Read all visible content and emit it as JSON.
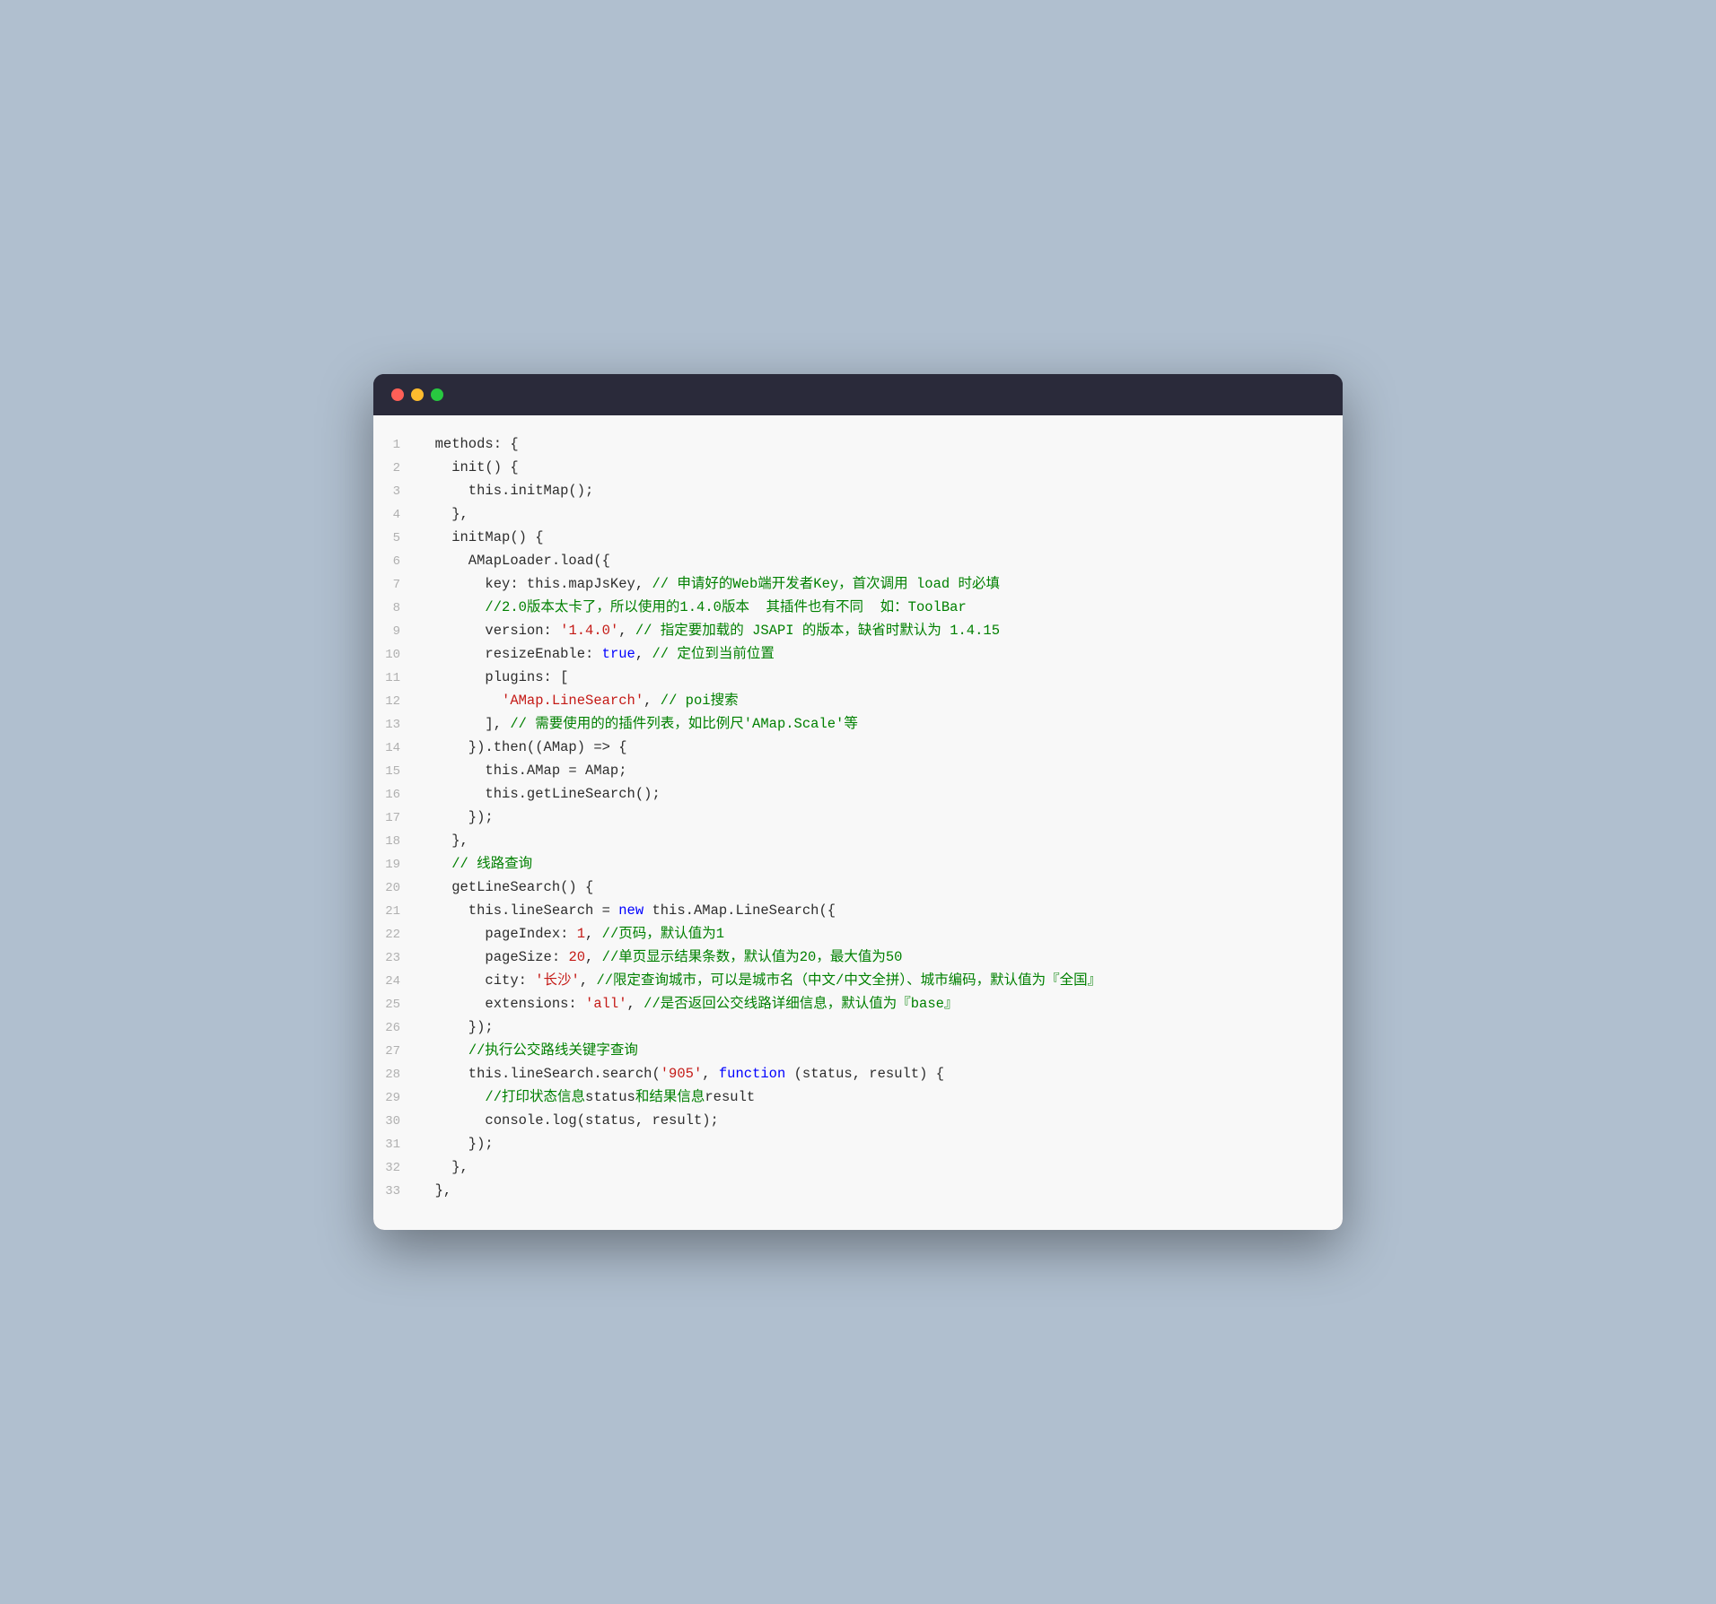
{
  "window": {
    "dots": [
      "red",
      "yellow",
      "green"
    ]
  },
  "lines": [
    {
      "num": 1,
      "tokens": [
        {
          "t": "  methods: {",
          "c": "c-default"
        }
      ]
    },
    {
      "num": 2,
      "tokens": [
        {
          "t": "    init() {",
          "c": "c-default"
        }
      ]
    },
    {
      "num": 3,
      "tokens": [
        {
          "t": "      this.initMap();",
          "c": "c-default"
        }
      ]
    },
    {
      "num": 4,
      "tokens": [
        {
          "t": "    },",
          "c": "c-default"
        }
      ]
    },
    {
      "num": 5,
      "tokens": [
        {
          "t": "    initMap() {",
          "c": "c-default"
        }
      ]
    },
    {
      "num": 6,
      "tokens": [
        {
          "t": "      AMapLoader.load({",
          "c": "c-default"
        }
      ]
    },
    {
      "num": 7,
      "tokens": [
        {
          "t": "        key: this.mapJsKey, ",
          "c": "c-default"
        },
        {
          "t": "// 申请好的Web端开发者Key，首次调用 load 时必填",
          "c": "c-comment"
        }
      ]
    },
    {
      "num": 8,
      "tokens": [
        {
          "t": "        ",
          "c": "c-default"
        },
        {
          "t": "//2.0版本太卡了，所以使用的1.4.0版本  其插件也有不同  如：ToolBar",
          "c": "c-comment"
        }
      ]
    },
    {
      "num": 9,
      "tokens": [
        {
          "t": "        version: ",
          "c": "c-default"
        },
        {
          "t": "'1.4.0'",
          "c": "c-string"
        },
        {
          "t": ", ",
          "c": "c-default"
        },
        {
          "t": "// 指定要加载的 JSAPI 的版本，缺省时默认为 1.4.15",
          "c": "c-comment"
        }
      ]
    },
    {
      "num": 10,
      "tokens": [
        {
          "t": "        resizeEnable: ",
          "c": "c-default"
        },
        {
          "t": "true",
          "c": "c-bool"
        },
        {
          "t": ", ",
          "c": "c-default"
        },
        {
          "t": "// 定位到当前位置",
          "c": "c-comment"
        }
      ]
    },
    {
      "num": 11,
      "tokens": [
        {
          "t": "        plugins: [",
          "c": "c-default"
        }
      ]
    },
    {
      "num": 12,
      "tokens": [
        {
          "t": "          ",
          "c": "c-default"
        },
        {
          "t": "'AMap.LineSearch'",
          "c": "c-string"
        },
        {
          "t": ", ",
          "c": "c-default"
        },
        {
          "t": "// poi搜索",
          "c": "c-comment"
        }
      ]
    },
    {
      "num": 13,
      "tokens": [
        {
          "t": "        ], ",
          "c": "c-default"
        },
        {
          "t": "// 需要使用的的插件列表，如比例尺'AMap.Scale'等",
          "c": "c-comment"
        }
      ]
    },
    {
      "num": 14,
      "tokens": [
        {
          "t": "      }).then((AMap) => {",
          "c": "c-default"
        }
      ]
    },
    {
      "num": 15,
      "tokens": [
        {
          "t": "        this.AMap = AMap;",
          "c": "c-default"
        }
      ]
    },
    {
      "num": 16,
      "tokens": [
        {
          "t": "        this.getLineSearch();",
          "c": "c-default"
        }
      ]
    },
    {
      "num": 17,
      "tokens": [
        {
          "t": "      });",
          "c": "c-default"
        }
      ]
    },
    {
      "num": 18,
      "tokens": [
        {
          "t": "    },",
          "c": "c-default"
        }
      ]
    },
    {
      "num": 19,
      "tokens": [
        {
          "t": "    ",
          "c": "c-default"
        },
        {
          "t": "// 线路查询",
          "c": "c-comment"
        }
      ]
    },
    {
      "num": 20,
      "tokens": [
        {
          "t": "    getLineSearch() {",
          "c": "c-default"
        }
      ]
    },
    {
      "num": 21,
      "tokens": [
        {
          "t": "      this.lineSearch = ",
          "c": "c-default"
        },
        {
          "t": "new",
          "c": "c-keyword"
        },
        {
          "t": " this.AMap.LineSearch({",
          "c": "c-default"
        }
      ]
    },
    {
      "num": 22,
      "tokens": [
        {
          "t": "        pageIndex: ",
          "c": "c-default"
        },
        {
          "t": "1",
          "c": "c-number"
        },
        {
          "t": ", ",
          "c": "c-default"
        },
        {
          "t": "//页码，默认值为1",
          "c": "c-comment"
        }
      ]
    },
    {
      "num": 23,
      "tokens": [
        {
          "t": "        pageSize: ",
          "c": "c-default"
        },
        {
          "t": "20",
          "c": "c-number"
        },
        {
          "t": ", ",
          "c": "c-default"
        },
        {
          "t": "//单页显示结果条数，默认值为20，最大值为50",
          "c": "c-comment"
        }
      ]
    },
    {
      "num": 24,
      "tokens": [
        {
          "t": "        city: ",
          "c": "c-default"
        },
        {
          "t": "'长沙'",
          "c": "c-string"
        },
        {
          "t": ", ",
          "c": "c-default"
        },
        {
          "t": "//限定查询城市，可以是城市名（中文/中文全拼）、城市编码，默认值为『全国』",
          "c": "c-comment"
        }
      ]
    },
    {
      "num": 25,
      "tokens": [
        {
          "t": "        extensions: ",
          "c": "c-default"
        },
        {
          "t": "'all'",
          "c": "c-string"
        },
        {
          "t": ", ",
          "c": "c-default"
        },
        {
          "t": "//是否返回公交线路详细信息，默认值为『base』",
          "c": "c-comment"
        }
      ]
    },
    {
      "num": 26,
      "tokens": [
        {
          "t": "      });",
          "c": "c-default"
        }
      ]
    },
    {
      "num": 27,
      "tokens": [
        {
          "t": "      ",
          "c": "c-default"
        },
        {
          "t": "//执行公交路线关键字查询",
          "c": "c-comment"
        }
      ]
    },
    {
      "num": 28,
      "tokens": [
        {
          "t": "      this.lineSearch.search(",
          "c": "c-default"
        },
        {
          "t": "'905'",
          "c": "c-string"
        },
        {
          "t": ", ",
          "c": "c-default"
        },
        {
          "t": "function",
          "c": "c-keyword"
        },
        {
          "t": " (status, result) {",
          "c": "c-default"
        }
      ]
    },
    {
      "num": 29,
      "tokens": [
        {
          "t": "        ",
          "c": "c-default"
        },
        {
          "t": "//打印状态信息",
          "c": "c-comment"
        },
        {
          "t": "status",
          "c": "c-default"
        },
        {
          "t": "和结果信息",
          "c": "c-comment"
        },
        {
          "t": "result",
          "c": "c-default"
        }
      ]
    },
    {
      "num": 30,
      "tokens": [
        {
          "t": "        console.log(status, result);",
          "c": "c-default"
        }
      ]
    },
    {
      "num": 31,
      "tokens": [
        {
          "t": "      });",
          "c": "c-default"
        }
      ]
    },
    {
      "num": 32,
      "tokens": [
        {
          "t": "    },",
          "c": "c-default"
        }
      ]
    },
    {
      "num": 33,
      "tokens": [
        {
          "t": "  },",
          "c": "c-default"
        }
      ]
    }
  ]
}
